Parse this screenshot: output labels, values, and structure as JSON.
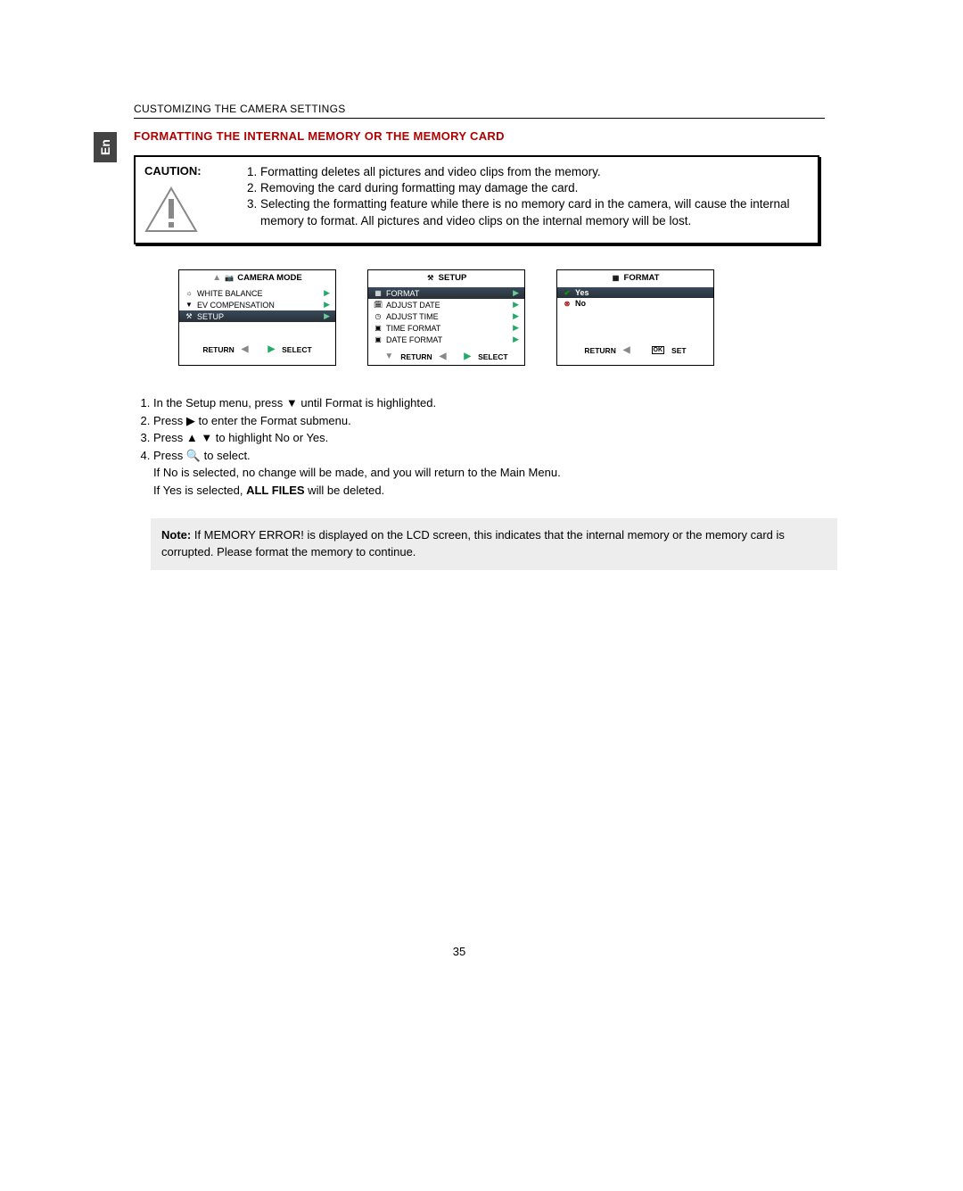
{
  "lang_tab": "En",
  "section_header": "CUSTOMIZING THE CAMERA SETTINGS",
  "title": "FORMATTING THE INTERNAL MEMORY OR THE MEMORY CARD",
  "caution_label": "CAUTION:",
  "caution_items": [
    "Formatting deletes all pictures and video clips from the memory.",
    "Removing the card during formatting may damage the card.",
    "Selecting the formatting feature while there is no memory card in the camera, will cause the internal memory to format. All pictures and video clips on the internal memory will be lost."
  ],
  "screens": {
    "camera_mode": {
      "title": "CAMERA MODE",
      "rows": [
        {
          "icon": "wb-icon",
          "label": "WHITE BALANCE"
        },
        {
          "icon": "ev-icon",
          "label": "EV COMPENSATION"
        },
        {
          "icon": "setup-icon",
          "label": "SETUP",
          "selected": true
        }
      ],
      "footer_left": "RETURN",
      "footer_right": "SELECT"
    },
    "setup": {
      "title": "SETUP",
      "rows": [
        {
          "icon": "format-icon",
          "label": "FORMAT",
          "selected": true
        },
        {
          "icon": "date-icon",
          "label": "ADJUST DATE"
        },
        {
          "icon": "time-icon",
          "label": "ADJUST TIME"
        },
        {
          "icon": "timefmt-icon",
          "label": "TIME FORMAT"
        },
        {
          "icon": "datefmt-icon",
          "label": "DATE FORMAT"
        }
      ],
      "footer_left": "RETURN",
      "footer_right": "SELECT"
    },
    "format": {
      "title": "FORMAT",
      "rows": [
        {
          "icon": "check-icon",
          "label": "Yes",
          "selected": true,
          "bold": true
        },
        {
          "icon": "cross-icon",
          "label": "No",
          "bold": true
        }
      ],
      "footer_left": "RETURN",
      "footer_right": "SET",
      "footer_right_icon": "OK"
    }
  },
  "steps": {
    "items": [
      "In the Setup menu, press  ▼  until Format is highlighted.",
      "Press  ▶  to enter the Format submenu.",
      "Press  ▲  ▼  to highlight No or Yes.",
      "Press  🔍  to select."
    ],
    "sub1": "If No is selected, no change will be made, and you will return to the Main Menu.",
    "sub2_prefix": "If Yes is selected, ",
    "sub2_bold": "ALL FILES",
    "sub2_suffix": " will be deleted."
  },
  "note": {
    "bold": "Note:",
    "text": "  If MEMORY ERROR! is displayed on the LCD screen, this indicates that the internal memory or the memory card is corrupted. Please format the memory to continue."
  },
  "page_number": "35"
}
